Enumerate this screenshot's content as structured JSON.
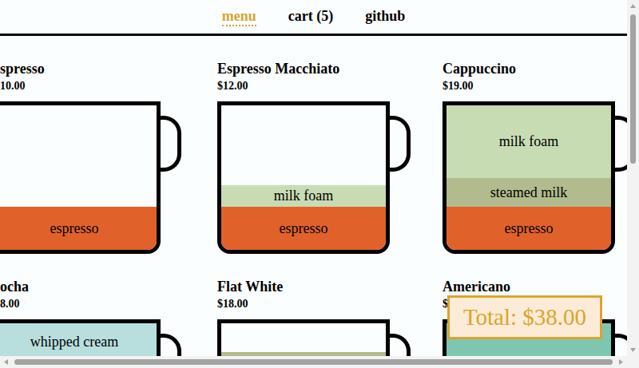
{
  "nav": [
    {
      "label": "menu",
      "selected": true
    },
    {
      "label": "cart (5)",
      "selected": false
    },
    {
      "label": "github",
      "selected": false
    }
  ],
  "menu_items": [
    {
      "name": "spresso",
      "price": "10.00",
      "fill": 0.3,
      "layers": [
        {
          "name": "espresso",
          "level": 0.3,
          "color": "#e0622a"
        }
      ]
    },
    {
      "name": "Espresso Macchiato",
      "price": "$12.00",
      "fill": 0.45,
      "layers": [
        {
          "name": "milk foam",
          "level": 0.15,
          "color": "#c8dcb4"
        },
        {
          "name": "espresso",
          "level": 0.3,
          "color": "#e0622a"
        }
      ]
    },
    {
      "name": "Cappuccino",
      "price": "$19.00",
      "fill": 1,
      "layers": [
        {
          "name": "milk foam",
          "level": 0.5,
          "color": "#c8dcb4"
        },
        {
          "name": "steamed milk",
          "level": 0.2,
          "color": "#b2bb8e"
        },
        {
          "name": "espresso",
          "level": 0.3,
          "color": "#e0622a"
        }
      ]
    },
    {
      "name": "ocha",
      "price": "8.00",
      "fill": 1,
      "layers": [
        {
          "name": "whipped cream",
          "level": 0.25,
          "color": "#b8dfdd"
        }
      ]
    },
    {
      "name": "Flat White",
      "price": "$18.00",
      "fill": 0.8,
      "layers": [
        {
          "level": 0.5,
          "color": "#b2bb8e"
        }
      ]
    },
    {
      "name": "Americano",
      "price": "$",
      "fill": 1,
      "layers": [
        {
          "level": 0.6,
          "color": "#7fc6b1"
        }
      ]
    }
  ],
  "total": {
    "label": "Total: $38.00"
  }
}
